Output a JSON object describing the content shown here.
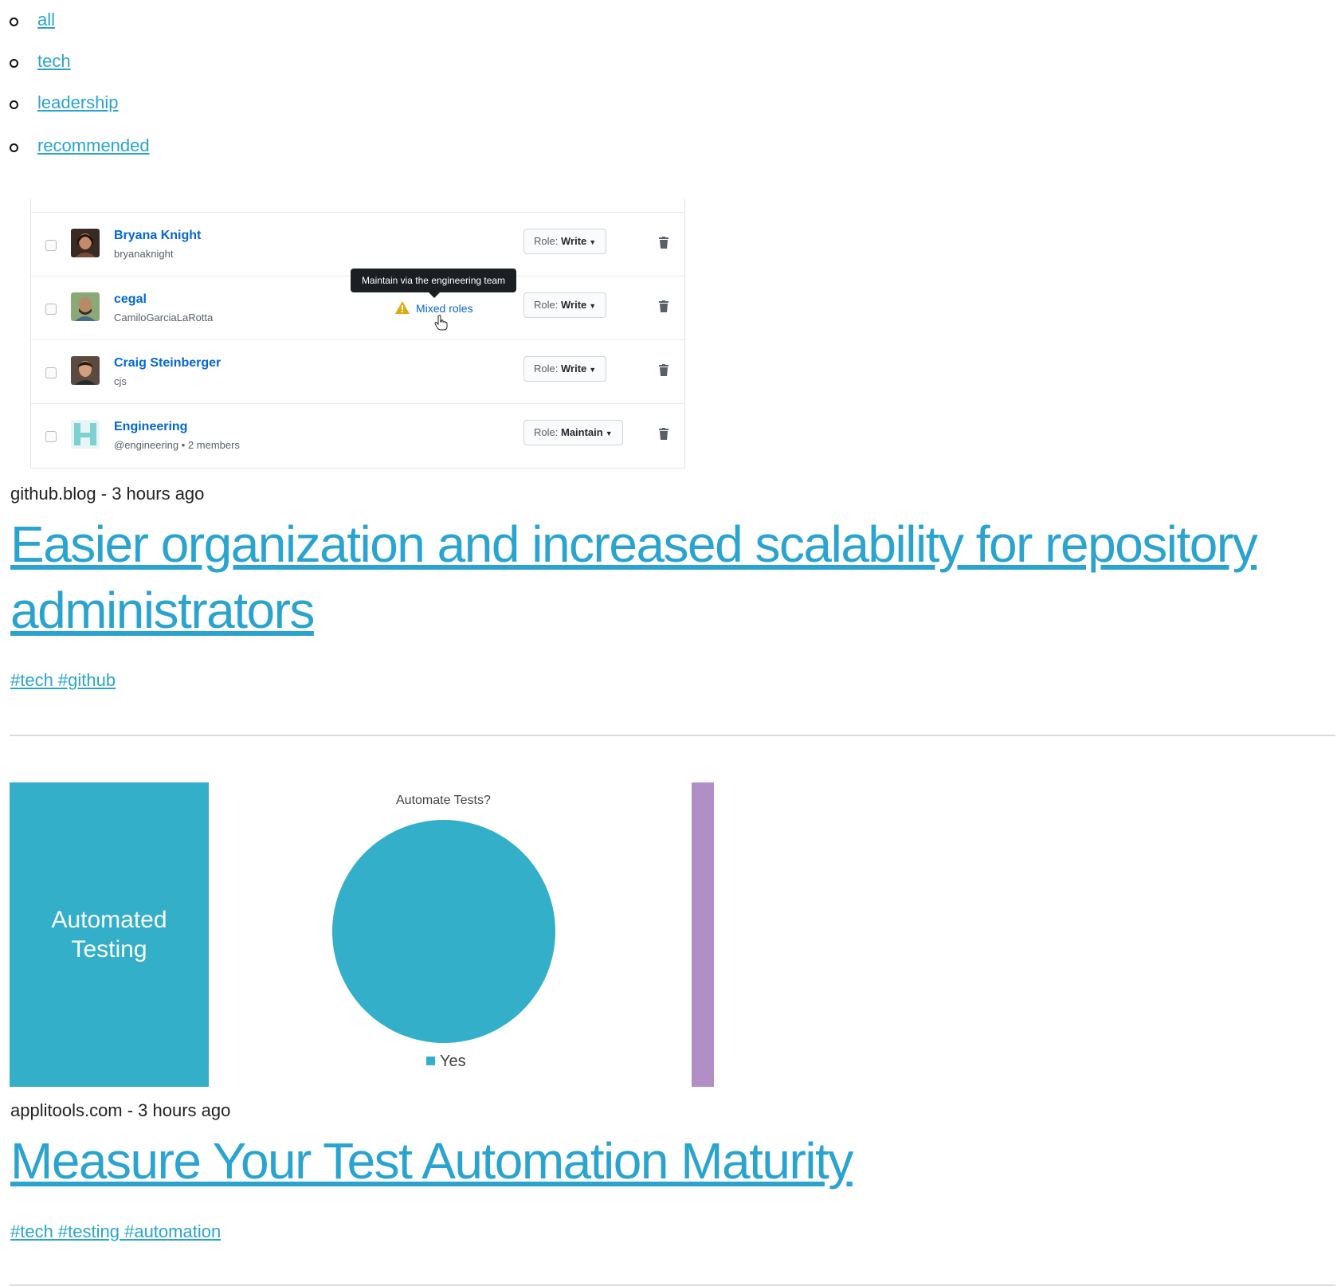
{
  "nav": {
    "items": [
      {
        "label": "all"
      },
      {
        "label": "tech"
      },
      {
        "label": "leadership"
      },
      {
        "label": "recommended"
      }
    ]
  },
  "posts": [
    {
      "image": {
        "rows": [
          {
            "name": "Bryana Knight",
            "login": "bryanaknight",
            "role_prefix": "Role:",
            "role": "Write"
          },
          {
            "name": "cegal",
            "login": "CamiloGarciaLaRotta",
            "role_prefix": "Role:",
            "role": "Write"
          },
          {
            "name": "Craig Steinberger",
            "login": "cjs",
            "role_prefix": "Role:",
            "role": "Write"
          },
          {
            "name": "Engineering",
            "login": "@engineering • 2 members",
            "role_prefix": "Role:",
            "role": "Maintain"
          }
        ],
        "tooltip": "Maintain via the engineering team",
        "mixed_roles": "Mixed roles",
        "link_color": "#0366d6"
      },
      "meta": "github.blog - 3 hours ago",
      "title": "Easier organization and increased scalability for repository administrators",
      "tags": "#tech #github"
    },
    {
      "image": {
        "panel_text": "Automated Testing",
        "chart_data": {
          "type": "pie",
          "title": "Automate Tests?",
          "categories": [
            "Yes"
          ],
          "values": [
            100
          ],
          "colors": [
            "#34afca"
          ],
          "legend": "bottom"
        },
        "panel_color": "#34afca",
        "strip_color": "#b18fc6"
      },
      "meta": "applitools.com - 3 hours ago",
      "title": "Measure Your Test Automation Maturity",
      "tags": "#tech #testing #automation"
    }
  ],
  "colors": {
    "link": "#2aa4cf",
    "divider": "#dcdcdc"
  }
}
